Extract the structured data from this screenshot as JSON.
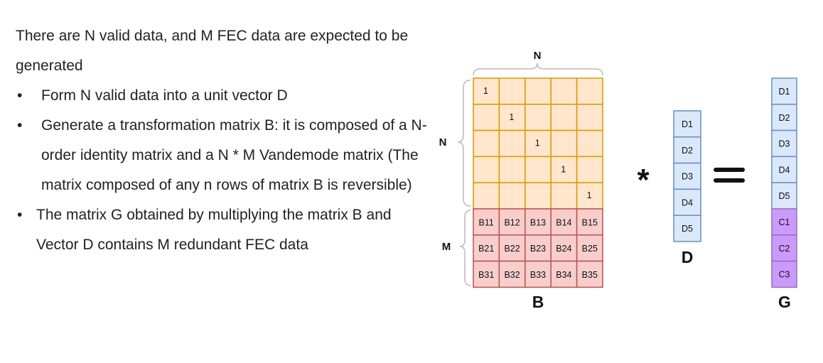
{
  "text": {
    "intro": "There are N valid data, and M FEC data are expected to be generated",
    "bullets": [
      "Form N valid data into a unit vector D",
      "Generate a transformation matrix B: it is composed of a N-order identity matrix and a N * M Vandemode matrix (The matrix composed of any n rows of matrix B is reversible)",
      "The matrix G obtained by multiplying the matrix B and Vector D contains M redundant FEC data"
    ],
    "bullet_symbol": "•"
  },
  "diagram": {
    "matrix_b": {
      "label": "B",
      "identity_value": "1",
      "vandermonde_rows": [
        [
          "B11",
          "B12",
          "B13",
          "B14",
          "B15"
        ],
        [
          "B21",
          "B22",
          "B23",
          "B24",
          "B25"
        ],
        [
          "B31",
          "B32",
          "B33",
          "B34",
          "B35"
        ]
      ],
      "brace_top_label": "N",
      "brace_left_top_label": "N",
      "brace_left_bottom_label": "M"
    },
    "vector_d": {
      "label": "D",
      "items": [
        "D1",
        "D2",
        "D3",
        "D4",
        "D5"
      ]
    },
    "vector_g": {
      "label": "G",
      "data_items": [
        "D1",
        "D2",
        "D3",
        "D4",
        "D5"
      ],
      "fec_items": [
        "C1",
        "C2",
        "C3"
      ]
    },
    "operators": {
      "multiply": "*",
      "equals": "="
    },
    "colors": {
      "identity_fill": "#ffe6cc",
      "identity_stroke": "#d79b00",
      "vander_fill": "#f8cecc",
      "vander_stroke": "#b85450",
      "d_fill": "#dae8fc",
      "d_stroke": "#6c8ebf",
      "c_fill": "#cc99ff",
      "c_stroke": "#9673a6",
      "brace": "#bbbbbb"
    }
  }
}
